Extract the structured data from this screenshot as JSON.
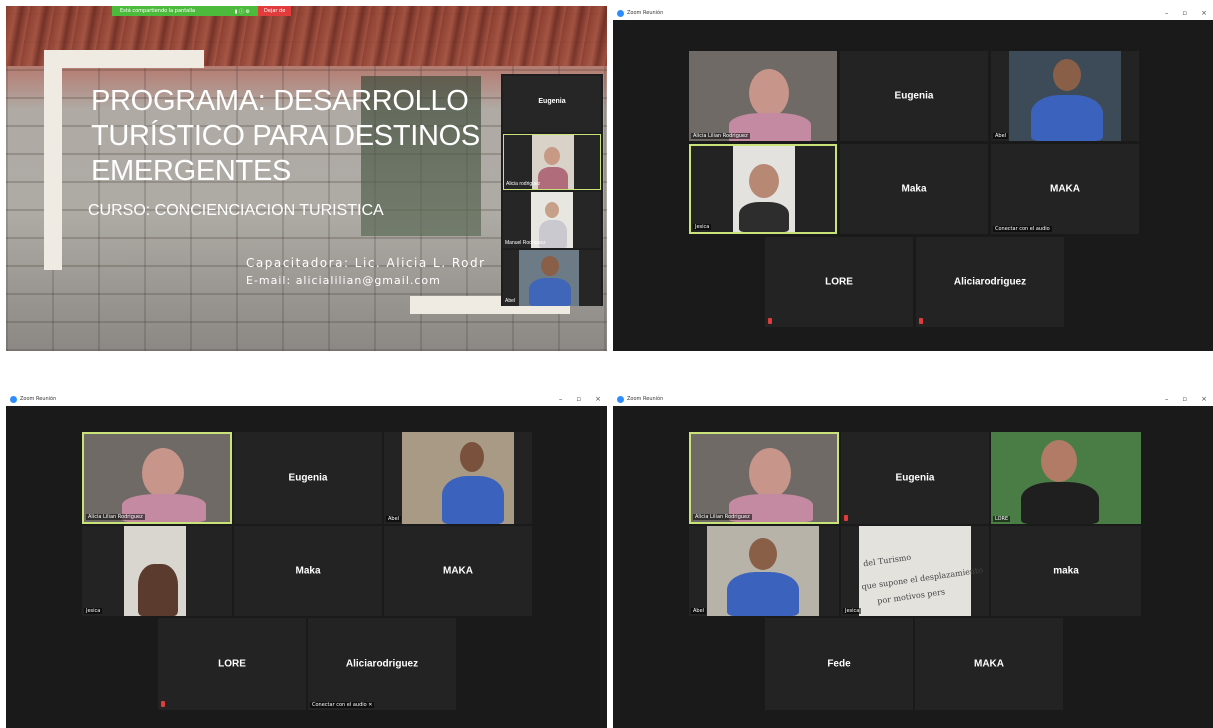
{
  "share_bar": {
    "status": "Está compartiendo la pantalla",
    "stop": "Dejar de"
  },
  "slide": {
    "title_lines": [
      "PROGRAMA: DESARROLLO",
      "TURÍSTICO PARA DESTINOS",
      "EMERGENTES"
    ],
    "course": "CURSO: CONCIENCIACION TURISTICA",
    "trainer": "Capacitadora: Lic. Alicia L. Rodr",
    "email": "E-mail: alicialilian@gmail.com"
  },
  "strip": {
    "tiles": [
      {
        "name": "Eugenia"
      },
      {
        "label": "Alicia rodriguez"
      },
      {
        "label": "Manuel Rodriguez"
      },
      {
        "label": "Abel"
      }
    ]
  },
  "window": {
    "title": "Zoom Reunión",
    "controls": [
      "–",
      "▫",
      "×"
    ]
  },
  "panel_b": {
    "tiles": [
      {
        "label": "Alicia Lilian Rodriguez"
      },
      {
        "name": "Eugenia"
      },
      {
        "label": "Abel"
      },
      {
        "label": "Jesica"
      },
      {
        "name": "Maka"
      },
      {
        "name": "MAKA",
        "label": "Conectar con el audio"
      },
      {
        "name": "LORE"
      },
      {
        "name": "Aliciarodriguez"
      }
    ]
  },
  "panel_c": {
    "tiles": [
      {
        "label": "Alicia Lilian Rodriguez"
      },
      {
        "name": "Eugenia"
      },
      {
        "label": "Abel"
      },
      {
        "label": "Jesica"
      },
      {
        "name": "Maka"
      },
      {
        "name": "MAKA"
      },
      {
        "name": "LORE"
      },
      {
        "name": "Aliciarodriguez",
        "label": "Conectar con el audio ✕"
      }
    ]
  },
  "panel_d": {
    "tiles": [
      {
        "label": "Alicia Lilian Rodriguez"
      },
      {
        "name": "Eugenia"
      },
      {
        "label": "LORE"
      },
      {
        "label": "Abel"
      },
      {
        "label": "Jesica",
        "text_lines": [
          "del Turismo",
          "que supone el desplazamiento",
          "por motivos pers"
        ]
      },
      {
        "name": "maka"
      },
      {
        "name": "Fede"
      },
      {
        "name": "MAKA"
      }
    ]
  },
  "colors": {
    "active_border": "#c9e37a",
    "share_green": "#4cbb3c",
    "stop_red": "#e23b3b",
    "tile_bg": "#232323",
    "panel_bg": "#1a1a1a"
  }
}
